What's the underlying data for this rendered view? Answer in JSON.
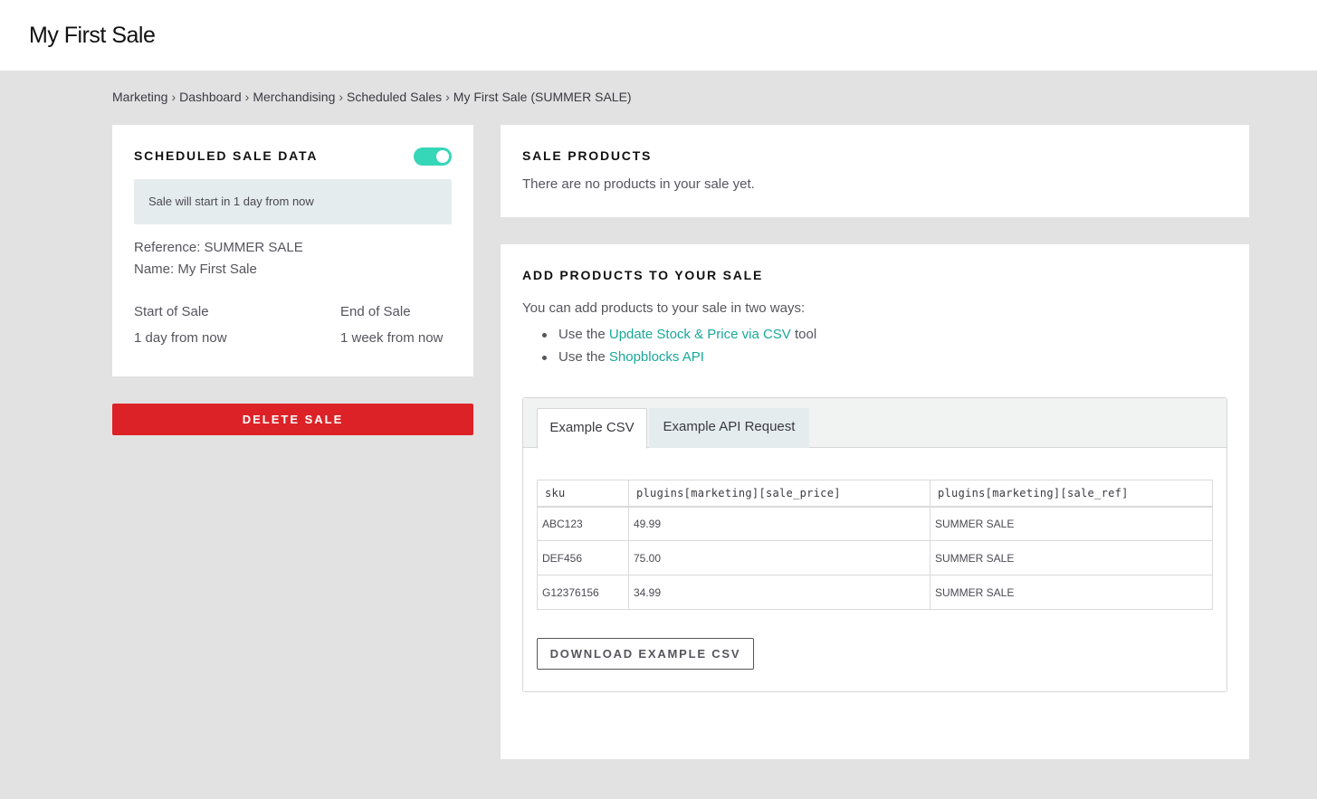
{
  "header": {
    "title": "My First Sale"
  },
  "breadcrumb": {
    "items": [
      "Marketing",
      "Dashboard",
      "Merchandising",
      "Scheduled Sales",
      "My First Sale (SUMMER SALE)"
    ],
    "separator": "›"
  },
  "scheduled_sale": {
    "title": "SCHEDULED SALE DATA",
    "toggle_on": true,
    "toggle_color": "#36d6b8",
    "notice": "Sale will start in 1 day from now",
    "reference": "Reference: SUMMER SALE",
    "name": "Name: My First Sale",
    "start_label": "Start of Sale",
    "start_value": "1 day from now",
    "end_label": "End of Sale",
    "end_value": "1 week from now"
  },
  "delete_button": {
    "label": "DELETE SALE",
    "color": "#dc2226"
  },
  "sale_products": {
    "title": "SALE PRODUCTS",
    "empty_text": "There are no products in your sale yet."
  },
  "add_products": {
    "title": "ADD PRODUCTS TO YOUR SALE",
    "intro": "You can add products to your sale in two ways:",
    "ways": [
      {
        "prefix": "Use the ",
        "link": "Update Stock & Price via CSV",
        "suffix": " tool"
      },
      {
        "prefix": "Use the ",
        "link": "Shopblocks API",
        "suffix": ""
      }
    ],
    "link_color": "#1aa89a",
    "tabs": [
      {
        "label": "Example CSV",
        "active": true
      },
      {
        "label": "Example API Request",
        "active": false
      }
    ],
    "csv_table": {
      "headers": [
        "sku",
        "plugins[marketing][sale_price]",
        "plugins[marketing][sale_ref]"
      ],
      "rows": [
        [
          "ABC123",
          "49.99",
          "SUMMER SALE"
        ],
        [
          "DEF456",
          "75.00",
          "SUMMER SALE"
        ],
        [
          "G12376156",
          "34.99",
          "SUMMER SALE"
        ]
      ]
    },
    "download_label": "DOWNLOAD EXAMPLE CSV"
  }
}
